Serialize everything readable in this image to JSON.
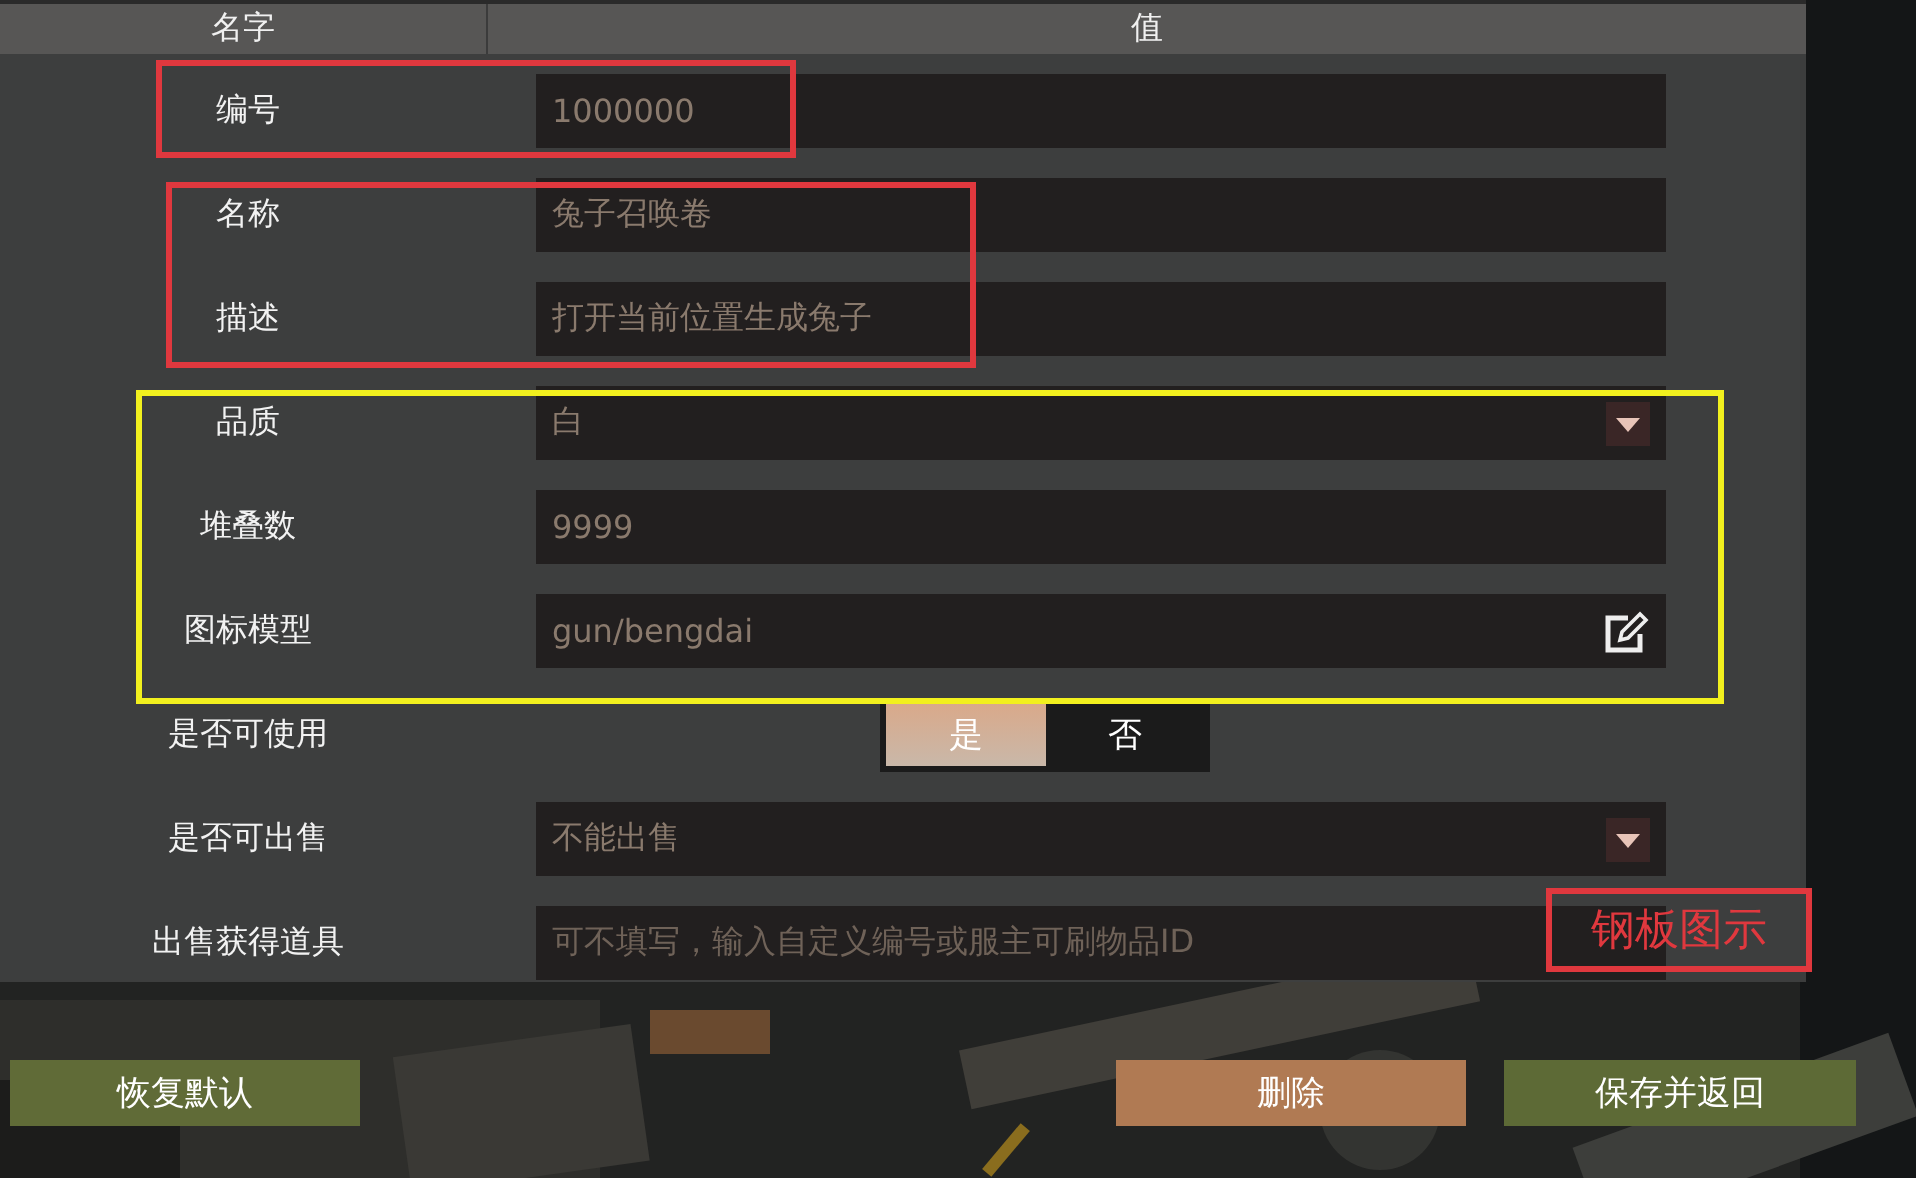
{
  "table": {
    "columns": [
      "名字",
      "值"
    ],
    "rows": [
      {
        "label": "编号",
        "kind": "text",
        "value": "1000000"
      },
      {
        "label": "名称",
        "kind": "text",
        "value": "兔子召唤卷"
      },
      {
        "label": "描述",
        "kind": "text",
        "value": "打开当前位置生成兔子"
      },
      {
        "label": "品质",
        "kind": "select",
        "value": "白"
      },
      {
        "label": "堆叠数",
        "kind": "text",
        "value": "9999"
      },
      {
        "label": "图标模型",
        "kind": "edit",
        "value": "gun/bengdai"
      },
      {
        "label": "是否可使用",
        "kind": "toggle",
        "options": [
          {
            "label": "是",
            "selected": true
          },
          {
            "label": "否",
            "selected": false
          }
        ]
      },
      {
        "label": "是否可出售",
        "kind": "select",
        "value": "不能出售"
      },
      {
        "label": "出售获得道具",
        "kind": "text",
        "placeholder": "可不填写，输入自定义编号或服主可刷物品ID"
      }
    ]
  },
  "annotations": [
    {
      "color": "#e0383e"
    },
    {
      "color": "#e0383e"
    },
    {
      "color": "#f2f01e"
    },
    {
      "color": "#e0383e",
      "text": "钢板图示"
    }
  ],
  "buttons": [
    {
      "label": "恢复默认",
      "kind": "reset"
    },
    {
      "label": "删除",
      "kind": "delete"
    },
    {
      "label": "保存并返回",
      "kind": "save"
    }
  ]
}
